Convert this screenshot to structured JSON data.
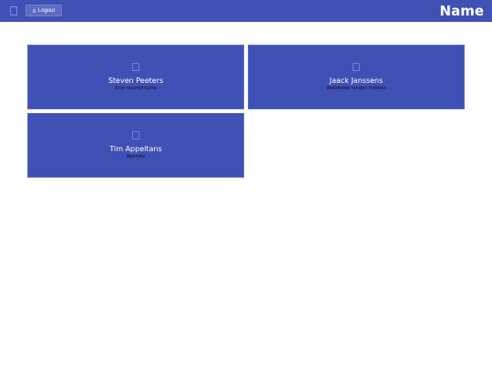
{
  "header": {
    "logout_label": "Logout",
    "brand": "Name"
  },
  "patients": [
    {
      "name": "Steven Peeters",
      "procedure": "Knie reconstructie"
    },
    {
      "name": "Jaack Janssens",
      "procedure": "Wetsheids tanden trekken"
    },
    {
      "name": "Tim Appeltans",
      "procedure": "Apendix"
    }
  ],
  "colors": {
    "primary": "#3f51b5",
    "button": "#5c6bc0"
  }
}
